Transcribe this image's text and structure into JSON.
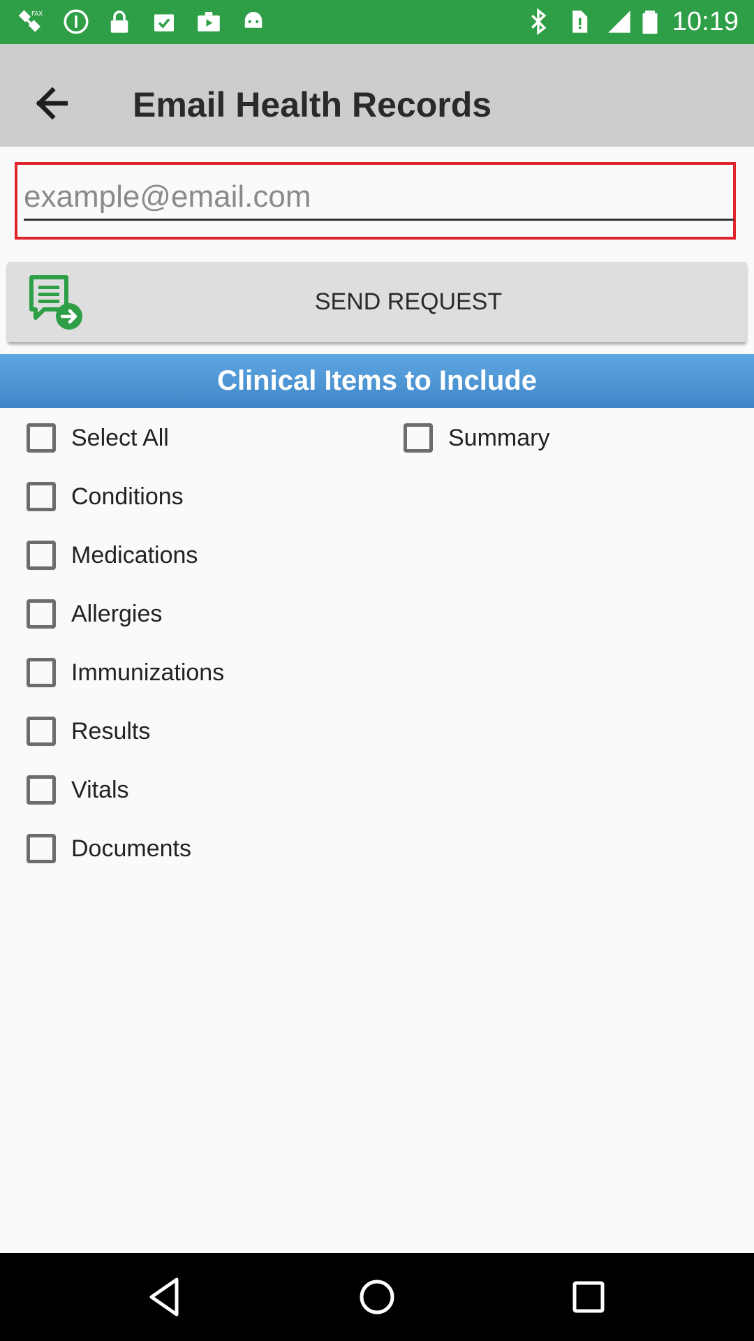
{
  "status_bar": {
    "time": "10:19",
    "left_icons": [
      "fax-satellite-icon",
      "alert-circle-icon",
      "lock-icon",
      "clipboard-check-icon",
      "briefcase-play-icon",
      "android-icon"
    ],
    "right_icons": [
      "bluetooth-icon",
      "no-sim-icon",
      "signal-icon",
      "battery-icon"
    ],
    "color": "#2e9f47"
  },
  "app_bar": {
    "title": "Email Health Records",
    "back_icon": "arrow-back-icon",
    "color": "#cdcdcd"
  },
  "email": {
    "placeholder": "example@email.com",
    "value": "",
    "highlight_color": "#e0242c"
  },
  "send_button": {
    "label": "SEND REQUEST",
    "icon": "message-send-icon",
    "icon_color": "#2e9f47"
  },
  "clinical": {
    "header": "Clinical Items to Include",
    "header_color": "#4a93d2",
    "items": [
      {
        "label": "Select All",
        "checked": false
      },
      {
        "label": "Summary",
        "checked": false
      },
      {
        "label": "Conditions",
        "checked": false
      },
      {
        "label": "Medications",
        "checked": false
      },
      {
        "label": "Allergies",
        "checked": false
      },
      {
        "label": "Immunizations",
        "checked": false
      },
      {
        "label": "Results",
        "checked": false
      },
      {
        "label": "Vitals",
        "checked": false
      },
      {
        "label": "Documents",
        "checked": false
      }
    ]
  },
  "nav_bar": {
    "buttons": [
      "back-triangle-icon",
      "home-circle-icon",
      "recents-square-icon"
    ]
  }
}
